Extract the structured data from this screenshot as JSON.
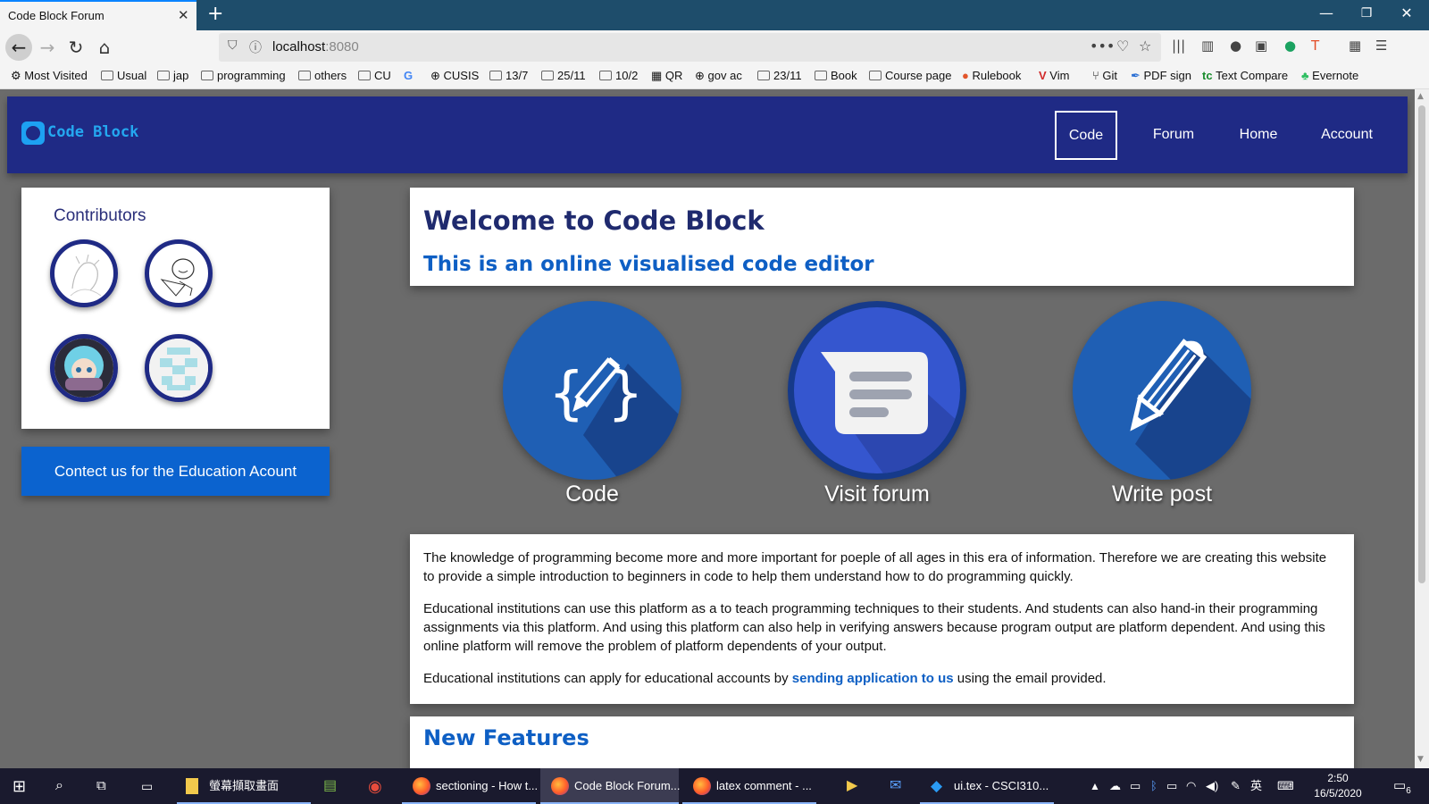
{
  "browser": {
    "tab_title": "Code Block Forum",
    "url_host": "localhost",
    "url_port": ":8080",
    "bookmarks": [
      "Most Visited",
      "Usual",
      "jap",
      "programming",
      "others",
      "CU",
      "CUSIS",
      "13/7",
      "25/11",
      "10/2",
      "QR",
      "gov ac",
      "23/11",
      "Book",
      "Course page",
      "Rulebook",
      "Vim",
      "Git",
      "PDF sign",
      "Text Compare",
      "Evernote"
    ]
  },
  "site": {
    "logo": "Code Block",
    "nav": [
      "Code",
      "Forum",
      "Home",
      "Account"
    ]
  },
  "sidebar": {
    "contributors_title": "Contributors",
    "contact_button": "Contect us for the Education Acount"
  },
  "welcome": {
    "title": "Welcome to Code Block",
    "subtitle": "This is an online visualised code editor"
  },
  "features": [
    {
      "label": "Code",
      "icon": "code-braces-pencil-icon"
    },
    {
      "label": "Visit forum",
      "icon": "chat-bubble-icon"
    },
    {
      "label": "Write post",
      "icon": "pencil-icon"
    }
  ],
  "about": {
    "p1": "The knowledge of programming become more and more important for poeple of all ages in this era of information. Therefore we are creating this website to provide a simple introduction to beginners in code to help them understand how to do programming quickly.",
    "p2": "Educational institutions can use this platform as a to teach programming techniques to their students. And students can also hand-in their programming assignments via this platform. And using this platform can also help in verifying answers because program output are platform dependent. And using this online platform will remove the problem of platform dependents of your output.",
    "p3_before": "Educational institutions can apply for educational accounts by ",
    "p3_link": "sending application to us",
    "p3_after": " using the email provided."
  },
  "new_features": {
    "title": "New Features"
  },
  "taskbar": {
    "apps": [
      "螢幕擷取畫面",
      "sectioning - How t...",
      "Code Block Forum...",
      "latex comment - ...",
      "ui.tex - CSCI310..."
    ],
    "ime": "英",
    "time": "2:50",
    "date": "16/5/2020",
    "notifications": "6"
  },
  "colors": {
    "site_header": "#1f2a85",
    "accent_blue": "#0e5fc4",
    "feature_circle": "#1f5fb4",
    "page_bg": "#6b6b6b"
  }
}
